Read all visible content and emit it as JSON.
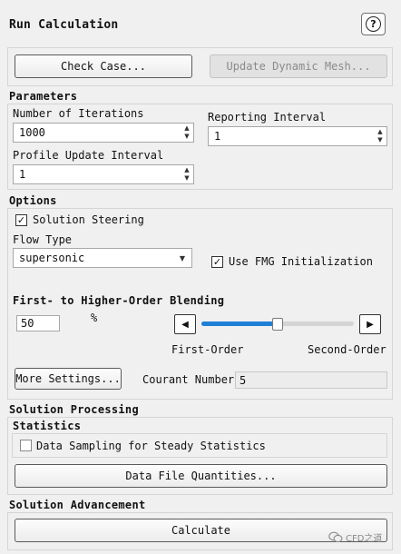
{
  "header": {
    "title": "Run Calculation",
    "help_glyph": "?"
  },
  "top_buttons": {
    "check_case": "Check Case...",
    "update_dynamic_mesh": "Update Dynamic Mesh..."
  },
  "parameters": {
    "heading": "Parameters",
    "iterations": {
      "label": "Number of Iterations",
      "value": "1000"
    },
    "reporting": {
      "label": "Reporting Interval",
      "value": "1"
    },
    "profile": {
      "label": "Profile Update Interval",
      "value": "1"
    }
  },
  "options": {
    "heading": "Options",
    "solution_steering": {
      "label": "Solution Steering",
      "checked": true
    },
    "flow_type": {
      "label": "Flow Type",
      "value": "supersonic"
    },
    "fmg": {
      "label": "Use FMG Initialization",
      "checked": true
    },
    "check_glyph": "✓"
  },
  "blending": {
    "heading": "First- to Higher-Order Blending",
    "value": "50",
    "unit": "%",
    "slider_fraction": 0.5,
    "left_label": "First-Order",
    "right_label": "Second-Order"
  },
  "more_settings": {
    "button": "More Settings...",
    "courant_label": "Courant Number",
    "courant_value": "5"
  },
  "solution_processing": {
    "heading": "Solution Processing",
    "statistics_heading": "Statistics",
    "data_sampling": {
      "label": "Data Sampling for Steady Statistics",
      "checked": false
    },
    "data_file_button": "Data File Quantities..."
  },
  "solution_advancement": {
    "heading": "Solution Advancement",
    "calculate_button": "Calculate"
  },
  "watermark": {
    "text": "CFD之道",
    "icon": "wechat-icon"
  },
  "colors": {
    "accent": "#1e7fd6",
    "panel_border": "#d5d5d5",
    "background": "#f0f0f0"
  }
}
